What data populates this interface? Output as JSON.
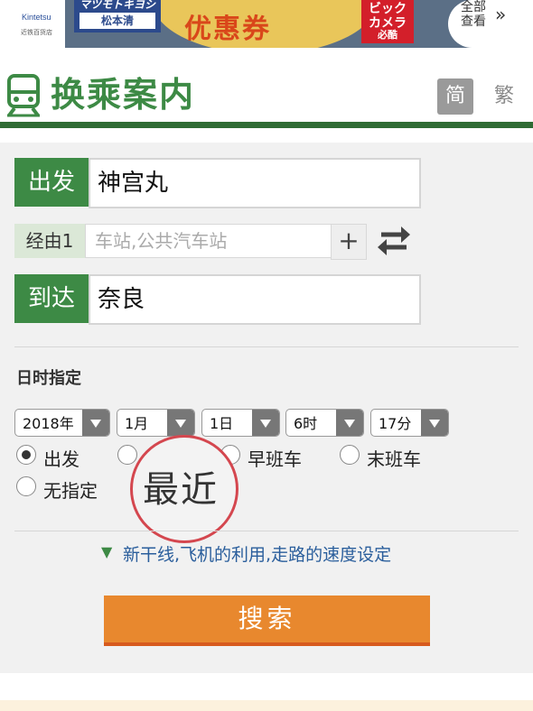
{
  "banner": {
    "kintetsu_logo": "Kintetsu",
    "kintetsu_sub": "近铁百货店",
    "mk_logo": "マツモトキヨシ",
    "mk_name": "松本清",
    "coupon": "优惠券",
    "camera": "ビック\nカメラ",
    "camera_sub": "必酷",
    "more_label": "全部\n查看",
    "more_arrow": "»"
  },
  "header": {
    "title": "换乘案内",
    "lang_simplified": "简",
    "lang_traditional": "繁"
  },
  "form": {
    "depart_label": "出发",
    "depart_value": "神宫丸",
    "via_label": "经由1",
    "via_placeholder": "车站,公共汽车站",
    "via_add": "+",
    "arrive_label": "到达",
    "arrive_value": "奈良",
    "date_label": "日时指定",
    "year": "2018年",
    "month": "1月",
    "day": "1日",
    "hour": "6时",
    "minute": "17分",
    "radio_depart": "出发",
    "radio_first": "早班车",
    "radio_last": "末班车",
    "radio_none": "无指定",
    "stamp": "最近",
    "more_settings": "新干线,飞机的利用,走路的速度设定",
    "search": "搜索"
  },
  "colors": {
    "brand_green": "#3d8a45",
    "dark_green": "#2f6b34",
    "button_orange": "#e8882e",
    "stamp_red": "#d4474f"
  }
}
